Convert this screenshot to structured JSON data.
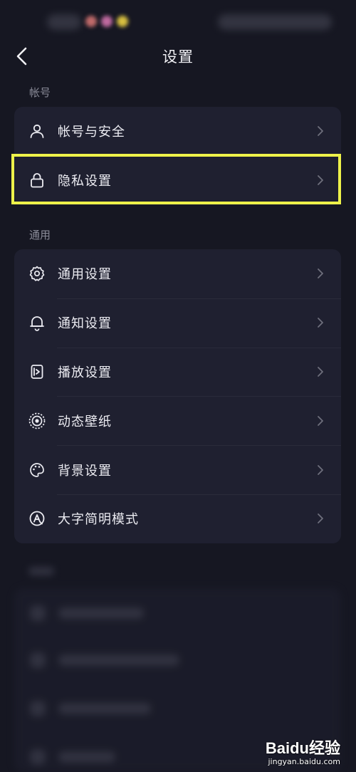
{
  "header": {
    "title": "设置"
  },
  "sections": {
    "account": {
      "label": "帐号",
      "items": [
        {
          "label": "帐号与安全",
          "icon": "user-icon"
        },
        {
          "label": "隐私设置",
          "icon": "lock-icon"
        }
      ]
    },
    "general": {
      "label": "通用",
      "items": [
        {
          "label": "通用设置",
          "icon": "gear-icon"
        },
        {
          "label": "通知设置",
          "icon": "bell-icon"
        },
        {
          "label": "播放设置",
          "icon": "play-settings-icon"
        },
        {
          "label": "动态壁纸",
          "icon": "live-wallpaper-icon"
        },
        {
          "label": "背景设置",
          "icon": "palette-icon"
        },
        {
          "label": "大字简明模式",
          "icon": "large-text-icon"
        }
      ]
    }
  },
  "highlight": {
    "target": "隐私设置",
    "color": "#eef24a"
  },
  "watermark": {
    "brand_left": "Bai",
    "brand_mid": "du",
    "brand_right": "经验",
    "url": "jingyan.baidu.com"
  },
  "colors": {
    "background": "#161722",
    "card": "#1f2030",
    "highlight": "#eef24a"
  }
}
